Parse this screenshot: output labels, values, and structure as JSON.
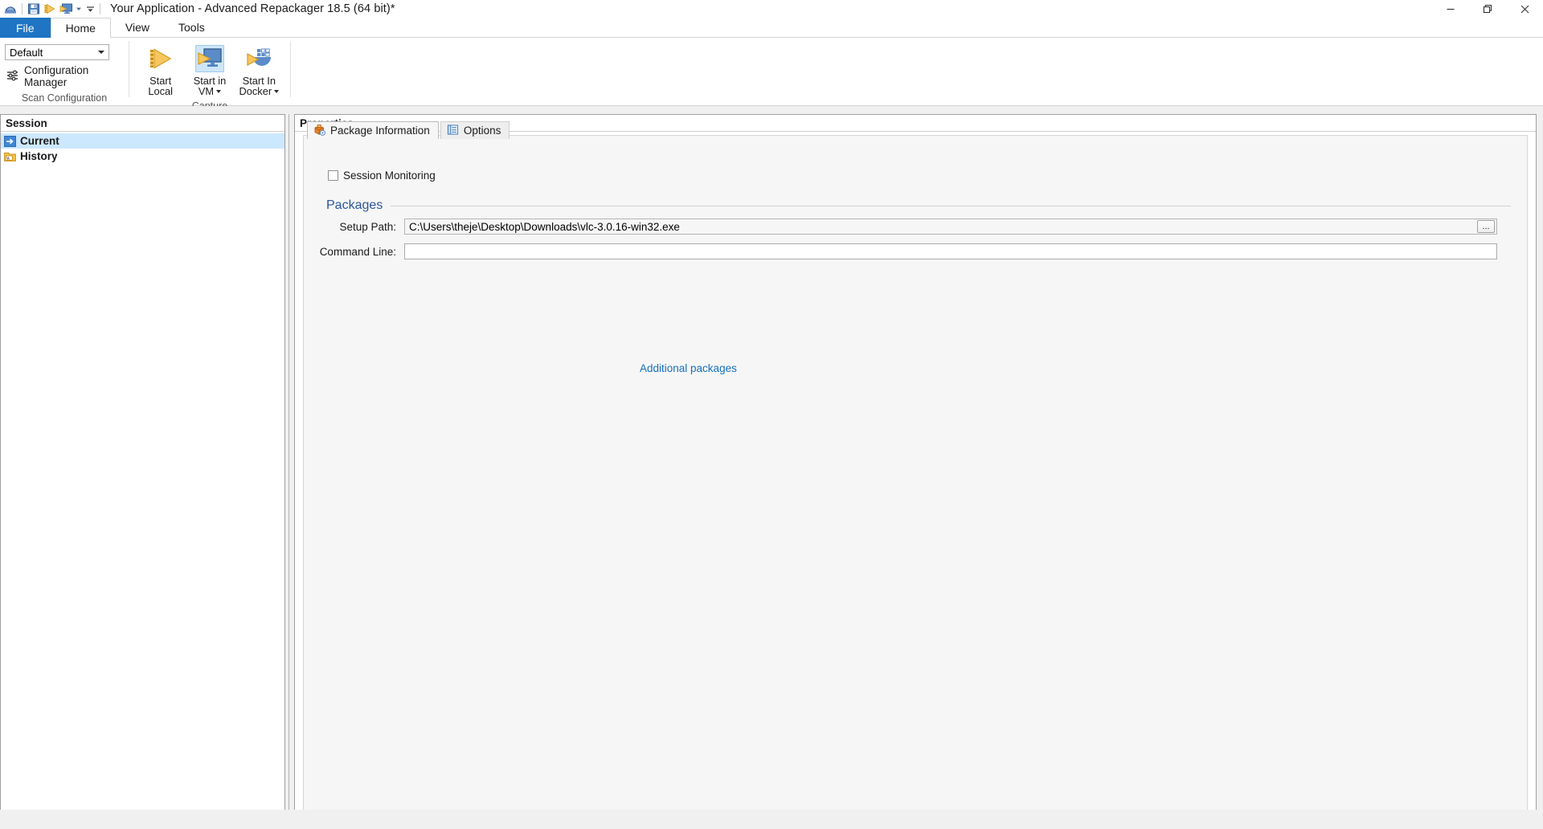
{
  "window": {
    "title": "Your Application - Advanced Repackager 18.5 (64 bit)*",
    "app_icon": "app-icon",
    "quick_access": [
      {
        "name": "save-icon",
        "label": "Save"
      },
      {
        "name": "start-local-icon",
        "label": "Start Local"
      },
      {
        "name": "start-in-vm-icon",
        "label": "Start in VM"
      },
      {
        "name": "vm-dropdown-caret",
        "label": ""
      },
      {
        "name": "customize-quick-access-caret",
        "label": ""
      }
    ],
    "controls": {
      "minimize": "minimize-icon",
      "restore": "restore-icon",
      "close": "close-icon"
    }
  },
  "ribbon": {
    "tabs": [
      {
        "label": "File",
        "active": false,
        "file": true
      },
      {
        "label": "Home",
        "active": true,
        "file": false
      },
      {
        "label": "View",
        "active": false,
        "file": false
      },
      {
        "label": "Tools",
        "active": false,
        "file": false
      }
    ],
    "groups": [
      {
        "label": "Scan Configuration",
        "combo_value": "Default",
        "config_manager_label": "Configuration Manager"
      },
      {
        "label": "Capture",
        "buttons": [
          {
            "line1": "Start",
            "line2": "Local",
            "icon": "start-local-icon",
            "dropdown": false,
            "active": false
          },
          {
            "line1": "Start in",
            "line2": "VM",
            "icon": "start-in-vm-icon",
            "dropdown": true,
            "active": true
          },
          {
            "line1": "Start In",
            "line2": "Docker",
            "icon": "start-in-docker-icon",
            "dropdown": true,
            "active": false
          }
        ]
      }
    ]
  },
  "session_pane": {
    "header": "Session",
    "items": [
      {
        "label": "Current",
        "icon": "current-session-arrow-icon",
        "selected": true
      },
      {
        "label": "History",
        "icon": "history-folder-icon",
        "selected": false
      }
    ]
  },
  "properties_pane": {
    "header": "Properties",
    "tabs": [
      {
        "label": "Package Information",
        "icon": "package-icon",
        "active": true
      },
      {
        "label": "Options",
        "icon": "options-list-icon",
        "active": false
      }
    ],
    "session_monitoring": {
      "label": "Session Monitoring",
      "checked": false
    },
    "packages_section": {
      "title": "Packages",
      "setup_path": {
        "label": "Setup Path:",
        "value": "C:\\Users\\theje\\Desktop\\Downloads\\vlc-3.0.16-win32.exe",
        "browse_label": "..."
      },
      "command_line": {
        "label": "Command Line:",
        "value": "",
        "placeholder": ""
      },
      "additional_packages_link": "Additional packages"
    }
  },
  "colors": {
    "accent_blue": "#1f74c4",
    "section_heading": "#2a5699",
    "link": "#1570c0",
    "selection": "#cce8ff",
    "icon_gold": "#f0b429",
    "icon_blue": "#4f81bd"
  }
}
